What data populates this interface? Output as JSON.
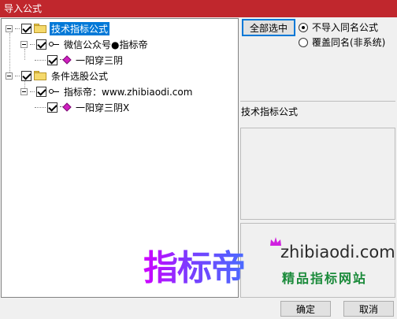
{
  "window": {
    "title": "导入公式"
  },
  "tree": {
    "groups": [
      {
        "label": "技术指标公式",
        "author": "微信公众号●指标帝",
        "item": "一阳穿三阴"
      },
      {
        "label": "条件选股公式",
        "author": "指标帝：www.zhibiaodi.com",
        "item": "一阳穿三阴X"
      }
    ]
  },
  "options": {
    "select_all": "全部选中",
    "radio_skip": "不导入同名公式",
    "radio_overwrite": "覆盖同名(非系统)"
  },
  "detail": {
    "formula_type": "技术指标公式"
  },
  "watermark": {
    "brand": "指标帝",
    "url": "zhibiaodi.com",
    "slogan": "精品指标网站"
  },
  "footer": {
    "ok": "确定",
    "cancel": "取消"
  },
  "colors": {
    "titlebar": "#c0272d",
    "selection": "#0078d7"
  }
}
